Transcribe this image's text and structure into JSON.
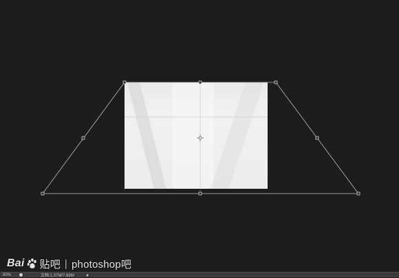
{
  "watermark": {
    "brand_prefix": "Bai",
    "brand_suffix": "贴吧",
    "separator": "|",
    "forum_name": "photoshop吧"
  },
  "status_bar": {
    "zoom": "50%",
    "doc_info": "文档:1.37M/7.68M"
  },
  "colors": {
    "canvas_bg": "#1d1d1d",
    "transform_line": "#bdbdbd",
    "status_bg": "#3a3a3a"
  }
}
